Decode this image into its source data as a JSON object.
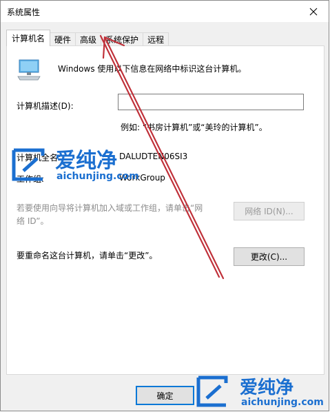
{
  "window": {
    "title": "系统属性"
  },
  "tabs": [
    {
      "label": "计算机名",
      "active": true
    },
    {
      "label": "硬件",
      "active": false
    },
    {
      "label": "高级",
      "active": false
    },
    {
      "label": "系统保护",
      "active": false
    },
    {
      "label": "远程",
      "active": false
    }
  ],
  "panel": {
    "info_text": "Windows 使用以下信息在网络中标识这台计算机。",
    "description": {
      "label": "计算机描述(D):",
      "value": "",
      "example": "例如: “书房计算机”或“美玲的计算机”。"
    },
    "full_name": {
      "label": "计算机全名:",
      "value": "DALUDTEN06SI3"
    },
    "workgroup": {
      "label": "工作组:",
      "value": "WorkGroup"
    },
    "network_hint": "若要使用向导将计算机加入域或工作组，请单击“网络 ID”。",
    "network_id_button": "网络 ID(N)...",
    "rename_text": "要重命名这台计算机，请单击“更改”。",
    "change_button": "更改(C)..."
  },
  "footer": {
    "ok_button": "确定"
  },
  "watermark": {
    "brand": "爱纯净",
    "url": "aichunjing.com",
    "color": "#1b6fd0"
  },
  "annotation": {
    "arrow_color": "#c0313a"
  }
}
